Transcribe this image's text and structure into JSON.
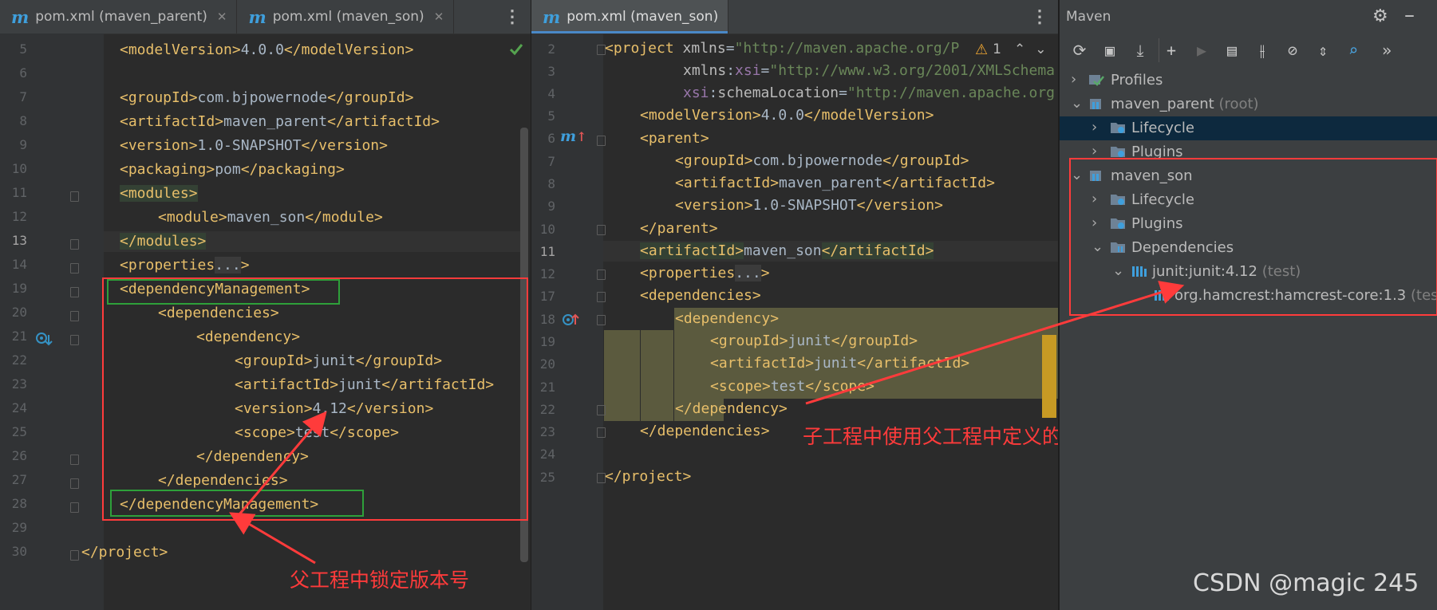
{
  "left_editor": {
    "tabs": [
      {
        "label": "pom.xml (maven_parent)",
        "close": "✕"
      },
      {
        "label": "pom.xml (maven_son)",
        "close": "✕"
      }
    ],
    "line_numbers": [
      "5",
      "6",
      "7",
      "8",
      "9",
      "10",
      "11",
      "12",
      "13",
      "14",
      "19",
      "20",
      "21",
      "22",
      "23",
      "24",
      "25",
      "26",
      "27",
      "28",
      "29",
      "30"
    ],
    "current_line": "13"
  },
  "mid_editor": {
    "tabs": [
      {
        "label": "pom.xml (maven_son)"
      }
    ],
    "warning_count": "1",
    "line_numbers": [
      "2",
      "3",
      "4",
      "5",
      "6",
      "7",
      "8",
      "9",
      "10",
      "11",
      "12",
      "17",
      "18",
      "19",
      "20",
      "21",
      "22",
      "23",
      "24",
      "25"
    ],
    "current_line": "11"
  },
  "maven": {
    "title": "Maven",
    "tree": [
      {
        "label": "Profiles",
        "suffix": ""
      },
      {
        "label": "maven_parent",
        "suffix": "(root)"
      },
      {
        "label": "Lifecycle",
        "suffix": ""
      },
      {
        "label": "Plugins",
        "suffix": ""
      },
      {
        "label": "maven_son",
        "suffix": ""
      },
      {
        "label": "Lifecycle",
        "suffix": ""
      },
      {
        "label": "Plugins",
        "suffix": ""
      },
      {
        "label": "Dependencies",
        "suffix": ""
      },
      {
        "label": "junit:junit:4.12",
        "suffix": "(test)"
      },
      {
        "label": "org.hamcrest:hamcrest-core:1.3",
        "suffix": "(test)"
      }
    ]
  },
  "annotations": {
    "parent_note": "父工程中锁定版本号",
    "son_note": "子工程中使用父工程中定义的版本号"
  },
  "watermark": "CSDN @magic 245",
  "colors": {
    "annotation_red": "#ff3b3b",
    "green_box": "#2ea03a",
    "tag": "#e8bf6a",
    "attr_value": "#6a8759"
  }
}
